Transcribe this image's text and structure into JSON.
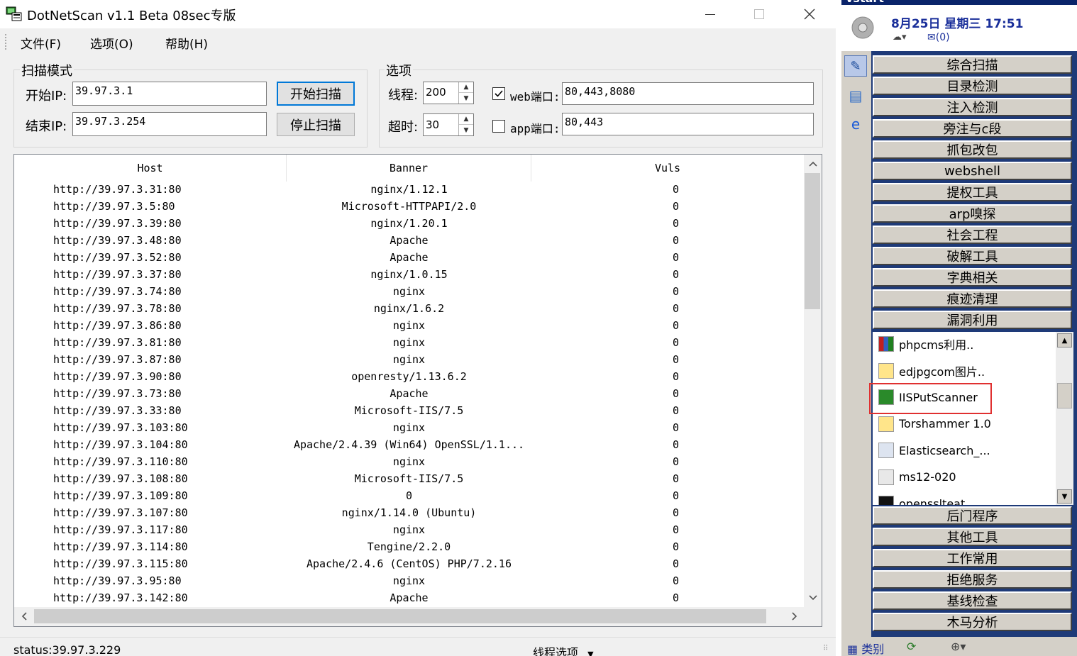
{
  "window": {
    "title": "DotNetScan v1.1 Beta 08sec专版",
    "menu": [
      "文件(F)",
      "选项(O)",
      "帮助(H)"
    ]
  },
  "scan_mode": {
    "group_title": "扫描模式",
    "start_ip_label": "开始IP:",
    "start_ip_value": "39.97.3.1",
    "end_ip_label": "结束IP:",
    "end_ip_value": "39.97.3.254",
    "start_button": "开始扫描",
    "stop_button": "停止扫描"
  },
  "options": {
    "group_title": "选项",
    "threads_label": "线程:",
    "threads_value": "200",
    "timeout_label": "超时:",
    "timeout_value": "30",
    "web_port_label": "web端口:",
    "web_port_checked": true,
    "web_port_value": "80,443,8080",
    "app_port_label": "app端口:",
    "app_port_checked": false,
    "app_port_value": "80,443"
  },
  "results": {
    "columns": [
      "Host",
      "Banner",
      "Vuls"
    ],
    "rows": [
      [
        "http://39.97.3.31:80",
        "nginx/1.12.1",
        "0"
      ],
      [
        "http://39.97.3.5:80",
        "Microsoft-HTTPAPI/2.0",
        "0"
      ],
      [
        "http://39.97.3.39:80",
        "nginx/1.20.1",
        "0"
      ],
      [
        "http://39.97.3.48:80",
        "Apache",
        "0"
      ],
      [
        "http://39.97.3.52:80",
        "Apache",
        "0"
      ],
      [
        "http://39.97.3.37:80",
        "nginx/1.0.15",
        "0"
      ],
      [
        "http://39.97.3.74:80",
        "nginx",
        "0"
      ],
      [
        "http://39.97.3.78:80",
        "nginx/1.6.2",
        "0"
      ],
      [
        "http://39.97.3.86:80",
        "nginx",
        "0"
      ],
      [
        "http://39.97.3.81:80",
        "nginx",
        "0"
      ],
      [
        "http://39.97.3.87:80",
        "nginx",
        "0"
      ],
      [
        "http://39.97.3.90:80",
        "openresty/1.13.6.2",
        "0"
      ],
      [
        "http://39.97.3.73:80",
        "Apache",
        "0"
      ],
      [
        "http://39.97.3.33:80",
        "Microsoft-IIS/7.5",
        "0"
      ],
      [
        "http://39.97.3.103:80",
        "nginx",
        "0"
      ],
      [
        "http://39.97.3.104:80",
        "Apache/2.4.39 (Win64) OpenSSL/1.1...",
        "0"
      ],
      [
        "http://39.97.3.110:80",
        "nginx",
        "0"
      ],
      [
        "http://39.97.3.108:80",
        "Microsoft-IIS/7.5",
        "0"
      ],
      [
        "http://39.97.3.109:80",
        "0",
        "0"
      ],
      [
        "http://39.97.3.107:80",
        "nginx/1.14.0 (Ubuntu)",
        "0"
      ],
      [
        "http://39.97.3.117:80",
        "nginx",
        "0"
      ],
      [
        "http://39.97.3.114:80",
        "Tengine/2.2.0",
        "0"
      ],
      [
        "http://39.97.3.115:80",
        "Apache/2.4.6 (CentOS) PHP/7.2.16",
        "0"
      ],
      [
        "http://39.97.3.95:80",
        "nginx",
        "0"
      ],
      [
        "http://39.97.3.142:80",
        "Apache",
        "0"
      ]
    ]
  },
  "statusbar": {
    "status": "status:39.97.3.229",
    "thread_options": "线程选项"
  },
  "side_panel": {
    "header": "vstart",
    "date": "8月25日 星期三 17:51",
    "mail": "(0)",
    "categories_top": [
      "综合扫描",
      "目录检测",
      "注入检测",
      "旁注与c段",
      "抓包改包",
      "webshell",
      "提权工具",
      "arp嗅探",
      "社会工程",
      "破解工具",
      "字典相关",
      "痕迹清理",
      "漏洞利用"
    ],
    "tools": [
      "phpcms利用..",
      "edjpgcom图片..",
      "IISPutScanner",
      "Torshammer 1.0",
      "Elasticsearch_...",
      "ms12-020",
      "opensslteat"
    ],
    "highlighted_tool": "IISPutScanner",
    "categories_bottom": [
      "后门程序",
      "其他工具",
      "工作常用",
      "拒绝服务",
      "基线检查",
      "木马分析"
    ],
    "bottom_label": "类别"
  }
}
